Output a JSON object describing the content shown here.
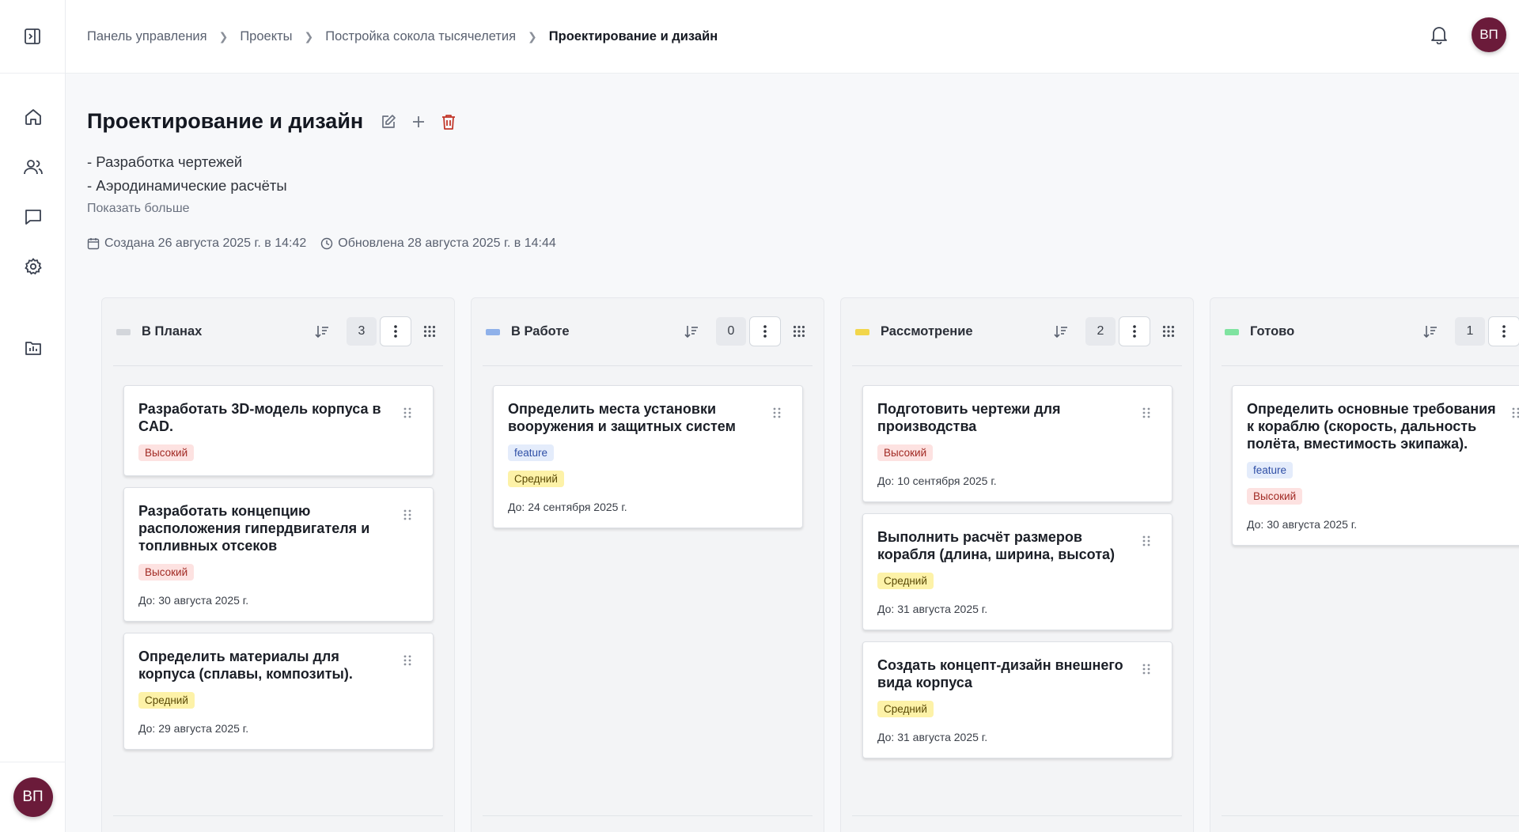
{
  "header": {
    "breadcrumbs": [
      "Панель управления",
      "Проекты",
      "Постройка сокола тысячелетия",
      "Проектирование и дизайн"
    ],
    "user_initials": "ВП"
  },
  "sidebar": {
    "items": [
      {
        "name": "home",
        "icon": "home-icon"
      },
      {
        "name": "users",
        "icon": "users-icon"
      },
      {
        "name": "messages",
        "icon": "chat-icon"
      },
      {
        "name": "settings",
        "icon": "gear-icon"
      },
      {
        "name": "reports",
        "icon": "chart-folder-icon"
      }
    ],
    "user_initials": "ВП"
  },
  "page": {
    "title": "Проектирование и дизайн",
    "description": [
      "- Разработка чертежей",
      "- Аэродинамические расчёты"
    ],
    "show_more": "Показать больше",
    "created": "Создана 26 августа 2025 г. в 14:42",
    "updated": "Обновлена 28 августа 2025 г. в 14:44"
  },
  "colors": {
    "avatar": "#6b1b3a",
    "priority_high_bg": "#fde2e1",
    "priority_mid_bg": "#fdf2a8",
    "feature_bg": "#e4ecfb",
    "delete": "#c2372a"
  },
  "columns": [
    {
      "title": "В Планах",
      "color": "#d3d6db",
      "count": "3",
      "cards": [
        {
          "title": "Разработать 3D-модель корпуса в CAD.",
          "tags": [
            {
              "label": "Высокий",
              "kind": "high"
            }
          ],
          "due": ""
        },
        {
          "title": "Разработать концепцию расположения гипердвигателя и топливных отсеков",
          "tags": [
            {
              "label": "Высокий",
              "kind": "high"
            }
          ],
          "due": "До: 30 августа 2025 г."
        },
        {
          "title": "Определить материалы для корпуса (сплавы, композиты).",
          "tags": [
            {
              "label": "Средний",
              "kind": "mid"
            }
          ],
          "due": "До: 29 августа 2025 г."
        }
      ]
    },
    {
      "title": "В Работе",
      "color": "#8fb1ea",
      "count": "0",
      "cards": [
        {
          "title": "Определить места установки вооружения и защитных систем",
          "tags": [
            {
              "label": "feature",
              "kind": "feature"
            },
            {
              "label": "Средний",
              "kind": "mid"
            }
          ],
          "due": "До: 24 сентября 2025 г."
        }
      ]
    },
    {
      "title": "Рассмотрение",
      "color": "#f2d64b",
      "count": "2",
      "cards": [
        {
          "title": "Подготовить чертежи для производства",
          "tags": [
            {
              "label": "Высокий",
              "kind": "high"
            }
          ],
          "due": "До: 10 сентября 2025 г."
        },
        {
          "title": "Выполнить расчёт размеров корабля (длина, ширина, высота)",
          "tags": [
            {
              "label": "Средний",
              "kind": "mid"
            }
          ],
          "due": "До: 31 августа 2025 г."
        },
        {
          "title": "Создать концепт-дизайн внешнего вида корпуса",
          "tags": [
            {
              "label": "Средний",
              "kind": "mid"
            }
          ],
          "due": "До: 31 августа 2025 г."
        }
      ]
    },
    {
      "title": "Готово",
      "color": "#7fe3a0",
      "count": "1",
      "cards": [
        {
          "title": "Определить основные требования к кораблю (скорость, дальность полёта, вместимость экипажа).",
          "tags": [
            {
              "label": "feature",
              "kind": "feature"
            },
            {
              "label": "Высокий",
              "kind": "high"
            }
          ],
          "due": "До: 30 августа 2025 г."
        }
      ]
    }
  ]
}
